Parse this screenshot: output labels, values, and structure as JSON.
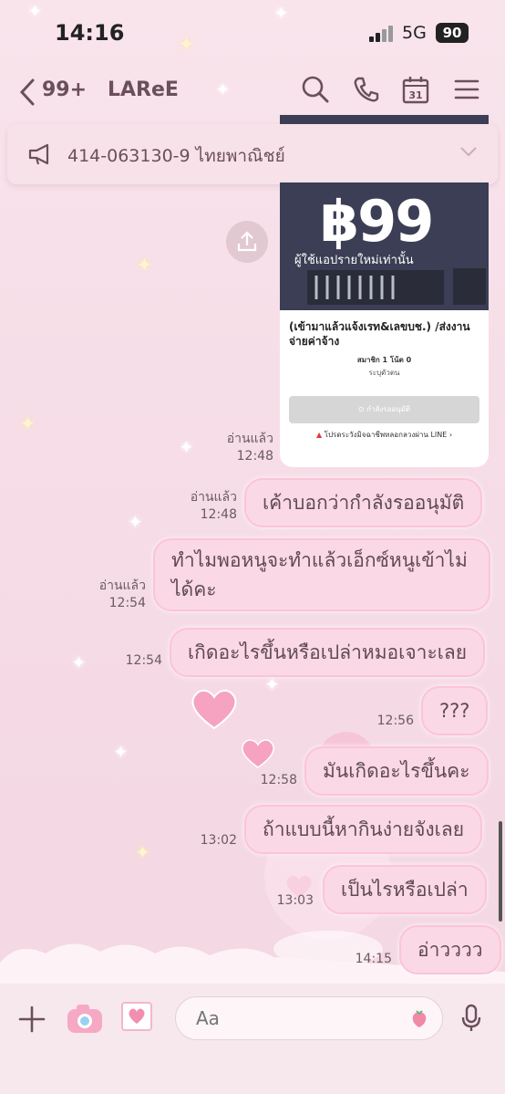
{
  "status_bar": {
    "time": "14:16",
    "network": "5G",
    "battery": "90"
  },
  "header": {
    "back_label": "<",
    "unread_count": "99+",
    "chat_name": "LAReE"
  },
  "announcement": {
    "text": "414-063130-9 ไทยพาณิชย์"
  },
  "card": {
    "price": "฿99",
    "price_sub": "ผู้ใช้แอปรายใหม่เท่านั้น",
    "title": "(เข้ามาแล้วแจ้งเรท&เลขบช.) /ส่งงาน จ่ายค่าจ้าง",
    "members": "สมาชิก 1 โน้ต 0",
    "note": "ระบุตัวตน",
    "button": "⊙ กำลังรออนุมัติ",
    "warning": "โปรดระวังมิจฉาชีพหลอกลวงผ่าน LINE ›"
  },
  "messages": [
    {
      "read": "อ่านแล้ว",
      "time": "12:48",
      "text": ""
    },
    {
      "read": "อ่านแล้ว",
      "time": "12:48",
      "text": "เค้าบอกว่ากำลังรออนุมัติ"
    },
    {
      "read": "อ่านแล้ว",
      "time": "12:54",
      "line1": "ทำไมพอหนูจะทำแล้วเอ็กซ์หนูเข้าไม่",
      "line2": "ได้คะ"
    },
    {
      "read": "",
      "time": "12:54",
      "text": "เกิดอะไรขึ้นหรือเปล่าหมอเจาะเลย"
    },
    {
      "read": "",
      "time": "12:56",
      "text": "???"
    },
    {
      "read": "",
      "time": "12:58",
      "text": "มันเกิดอะไรขึ้นคะ"
    },
    {
      "read": "",
      "time": "13:02",
      "text": "ถ้าแบบนี้หากินง่ายจังเลย"
    },
    {
      "read": "",
      "time": "13:03",
      "text": "เป็นไรหรือเปล่า"
    },
    {
      "read": "",
      "time": "14:15",
      "text": "อ่าวววว"
    }
  ],
  "input": {
    "placeholder": "Aa"
  },
  "icons": [
    "back-icon",
    "search-icon",
    "phone-icon",
    "calendar-icon",
    "menu-icon",
    "megaphone-icon",
    "chevron-down-icon",
    "share-icon",
    "plus-icon",
    "camera-icon",
    "image-icon",
    "sticker-icon",
    "mic-icon"
  ],
  "calendar_day": "31",
  "colors": {
    "bubble": "#fbd8e6",
    "bubble_border": "#fcc4d6",
    "accent_text": "#6b4f5a",
    "background": "#f6dde7"
  }
}
